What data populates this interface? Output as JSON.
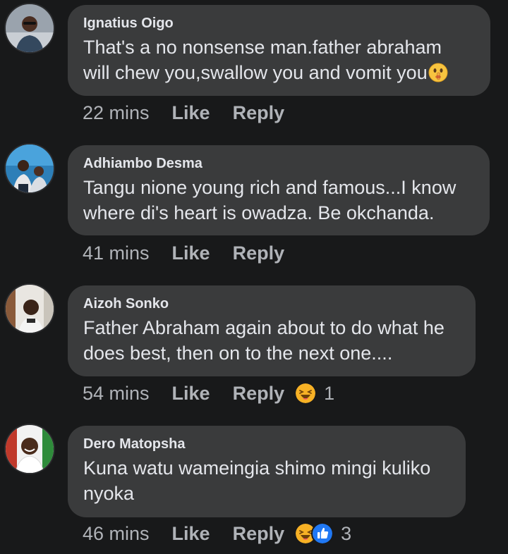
{
  "comments": [
    {
      "author": "Ignatius Oigo",
      "text": "That's a no nonsense  man.father abraham\nwill chew you,swallow  you and vomit you",
      "emoji": "shushing-face-icon",
      "time": "22 mins",
      "like_label": "Like",
      "reply_label": "Reply",
      "reactions": [],
      "reaction_count": ""
    },
    {
      "author": "Adhiambo Desma",
      "text": "Tangu nione young rich and famous...I know\nwhere di's heart is owadza. Be okchanda.",
      "time": "41 mins",
      "like_label": "Like",
      "reply_label": "Reply",
      "reactions": [],
      "reaction_count": ""
    },
    {
      "author": "Aizoh Sonko",
      "text": "Father Abraham again about to do what he\ndoes best, then on to the next one....",
      "time": "54 mins",
      "like_label": "Like",
      "reply_label": "Reply",
      "reactions": [
        "haha-reaction-icon"
      ],
      "reaction_count": "1"
    },
    {
      "author": "Dero Matopsha",
      "text": "Kuna watu wameingia shimo mingi kuliko\nnyoka",
      "time": "46 mins",
      "like_label": "Like",
      "reply_label": "Reply",
      "reactions": [
        "haha-reaction-icon",
        "like-reaction-icon"
      ],
      "reaction_count": "3"
    }
  ],
  "colors": {
    "background": "#18191a",
    "bubble": "#3a3b3c",
    "primary_text": "#e4e6eb",
    "secondary_text": "#b0b3b8",
    "like_blue": "#2078f4",
    "haha_yellow": "#f7b125"
  }
}
